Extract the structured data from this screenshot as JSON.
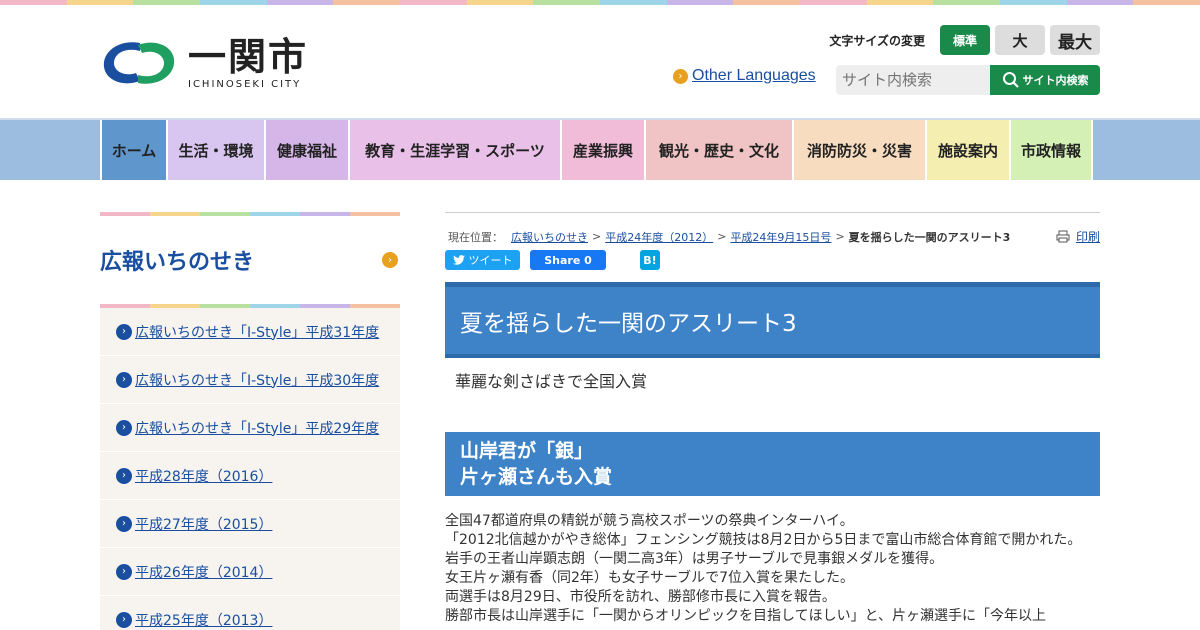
{
  "header": {
    "logo": {
      "kanji": "一関市",
      "roman": "ICHINOSEKI CITY",
      "colors": {
        "blue": "#1a4fa0",
        "green": "#20a060"
      }
    },
    "font_size": {
      "label": "文字サイズの変更",
      "standard": "標準",
      "large": "大",
      "max": "最大"
    },
    "other_languages": "Other Languages",
    "search": {
      "placeholder": "サイト内検索",
      "button": "サイト内検索"
    }
  },
  "nav": {
    "items": [
      {
        "label": "ホーム",
        "color": "#5f96cc",
        "width": 66
      },
      {
        "label": "生活・環境",
        "color": "#d8c6f0",
        "width": 98
      },
      {
        "label": "健康福祉",
        "color": "#d6b6e8",
        "width": 84
      },
      {
        "label": "教育・生涯学習・スポーツ",
        "color": "#e8c0e8",
        "width": 212
      },
      {
        "label": "産業振興",
        "color": "#f0bcd8",
        "width": 84
      },
      {
        "label": "観光・歴史・文化",
        "color": "#f0c4c4",
        "width": 148
      },
      {
        "label": "消防防災・災害",
        "color": "#f8dcc0",
        "width": 133
      },
      {
        "label": "施設案内",
        "color": "#f4eeb0",
        "width": 84
      },
      {
        "label": "市政情報",
        "color": "#d4f0b4",
        "width": 84
      }
    ]
  },
  "sidebar": {
    "title": "広報いちのせき",
    "items": [
      "広報いちのせき「I-Style」平成31年度",
      "広報いちのせき「I-Style」平成30年度",
      "広報いちのせき「I-Style」平成29年度",
      "平成28年度（2016）",
      "平成27年度（2015）",
      "平成26年度（2014）",
      "平成25年度（2013）"
    ]
  },
  "breadcrumb": {
    "label": "現在位置：",
    "links": [
      "広報いちのせき",
      "平成24年度（2012）",
      "平成24年9月15日号"
    ],
    "current": "夏を揺らした一関のアスリート3"
  },
  "print": "印刷",
  "share": {
    "tweet": "ツイート",
    "facebook": "Share 0",
    "hatena": "B!"
  },
  "article": {
    "title": "夏を揺らした一関のアスリート3",
    "subtitle": "華麗な剣さばきで全国入賞",
    "section_heading_line1": "山岸君が「銀」",
    "section_heading_line2": "片ヶ瀬さんも入賞",
    "body": [
      "全国47都道府県の精鋭が競う高校スポーツの祭典インターハイ。",
      "「2012北信越かがやき総体」フェンシング競技は8月2日から5日まで富山市総合体育館で開かれた。",
      "岩手の王者山岸顕志朗（一関二高3年）は男子サーブルで見事銀メダルを獲得。",
      "女王片ヶ瀬有香（同2年）も女子サーブルで7位入賞を果たした。",
      "両選手は8月29日、市役所を訪れ、勝部修市長に入賞を報告。",
      "勝部市長は山岸選手に「一関からオリンピックを目指してほしい」と、片ヶ瀬選手に「今年以上"
    ]
  }
}
